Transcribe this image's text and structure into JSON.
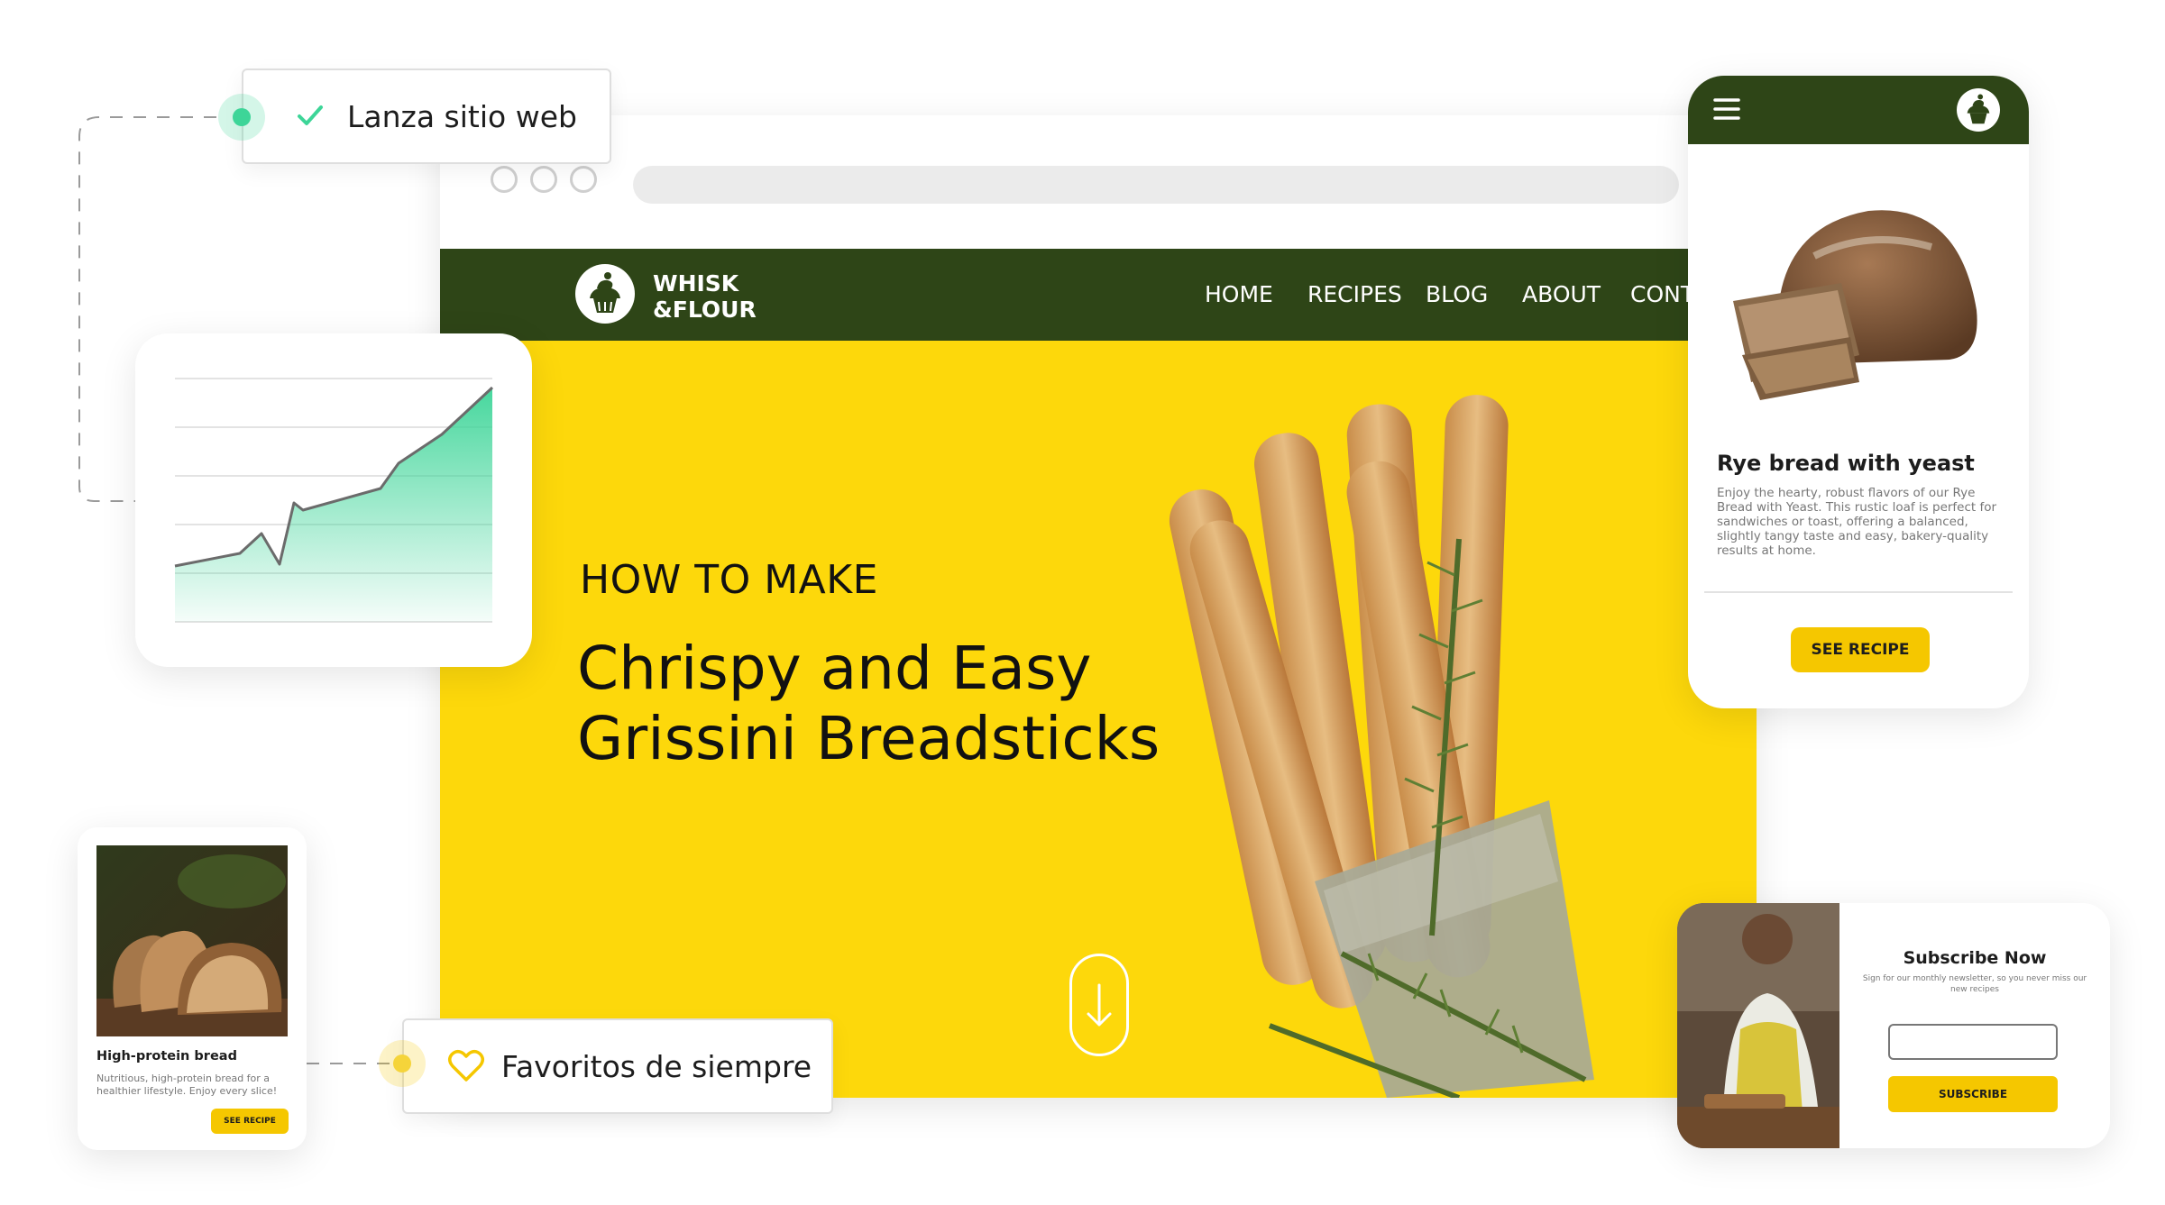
{
  "badges": {
    "launch": "Lanza sitio web",
    "favorites": "Favoritos de siempre"
  },
  "site": {
    "brand_line1": "WHISK",
    "brand_line2": "&FLOUR",
    "nav": [
      "HOME",
      "RECIPES",
      "BLOG",
      "ABOUT",
      "CONTA"
    ],
    "hero_kicker": "HOW TO MAKE",
    "hero_title_line1": "Chrispy and Easy",
    "hero_title_line2": "Grissini Breadsticks"
  },
  "mobile": {
    "title": "Rye bread with yeast",
    "description": "Enjoy the hearty, robust flavors of our Rye Bread with Yeast. This rustic loaf is perfect for sandwiches or toast, offering a balanced, slightly tangy taste and easy, bakery-quality results at home.",
    "button": "SEE RECIPE"
  },
  "small_card": {
    "title": "High-protein bread",
    "description": "Nutritious, high-protein bread for a healthier lifestyle. Enjoy every slice!",
    "button": "SEE RECIPE"
  },
  "subscribe": {
    "title": "Subscribe Now",
    "subtitle": "Sign for our monthly newsletter, so you never miss our new recipes",
    "email_value": "",
    "button": "SUBSCRIBE"
  },
  "colors": {
    "brand_green": "#2e4517",
    "hero_yellow": "#fdd80b",
    "button_yellow": "#f5c700",
    "accent_teal": "#3dd598"
  },
  "icons": {
    "check": "check-icon",
    "heart": "heart-outline-icon",
    "menu": "hamburger-menu-icon",
    "logo": "cupcake-logo-icon",
    "scroll": "arrow-down-icon"
  }
}
